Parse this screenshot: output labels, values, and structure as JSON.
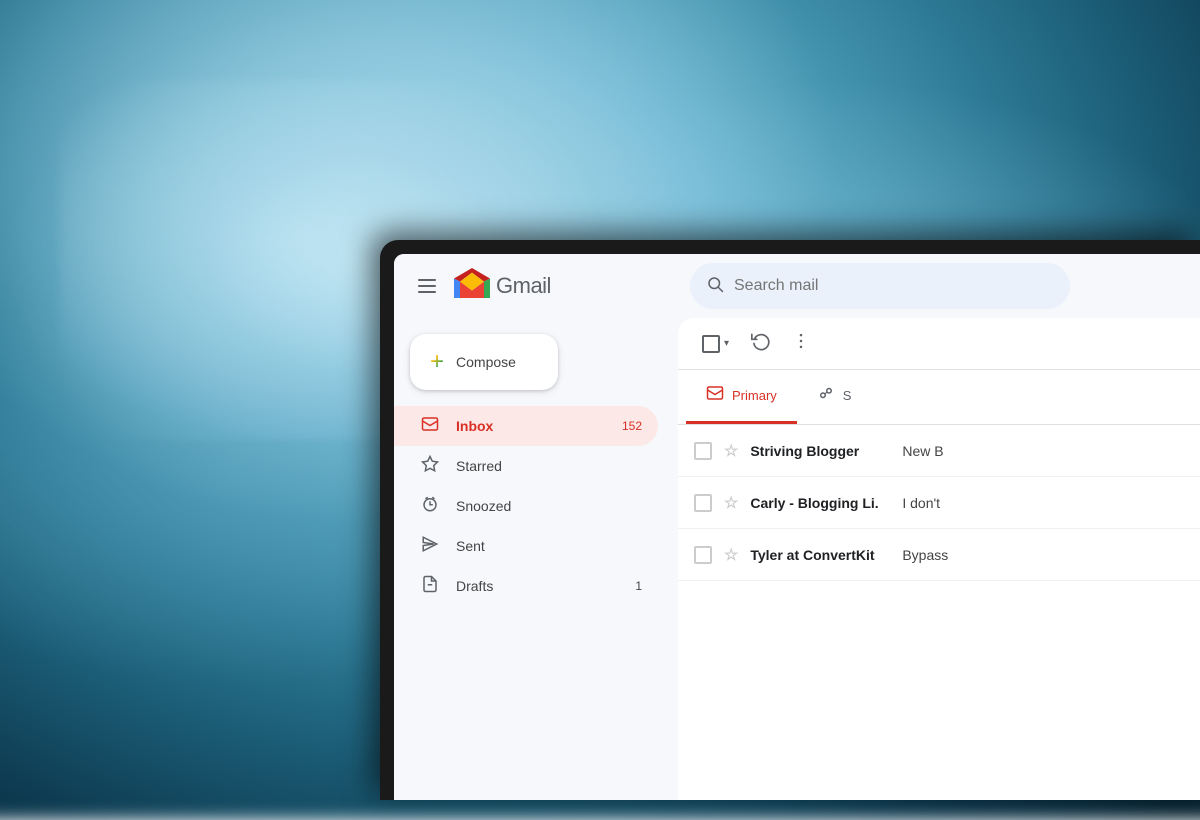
{
  "background": {
    "description": "blurred ocean water background"
  },
  "header": {
    "menu_label": "Main menu",
    "logo_m": "M",
    "app_name": "Gmail",
    "search_placeholder": "Search mail"
  },
  "compose": {
    "label": "Compose",
    "plus_symbol": "+"
  },
  "sidebar": {
    "items": [
      {
        "id": "inbox",
        "label": "Inbox",
        "icon": "inbox",
        "count": "152",
        "active": true
      },
      {
        "id": "starred",
        "label": "Starred",
        "icon": "star",
        "count": "",
        "active": false
      },
      {
        "id": "snoozed",
        "label": "Snoozed",
        "icon": "snoozed",
        "count": "",
        "active": false
      },
      {
        "id": "sent",
        "label": "Sent",
        "icon": "sent",
        "count": "",
        "active": false
      },
      {
        "id": "drafts",
        "label": "Drafts",
        "icon": "drafts",
        "count": "1",
        "active": false
      }
    ]
  },
  "toolbar": {
    "select_all_label": "Select",
    "refresh_label": "Refresh",
    "more_label": "More"
  },
  "tabs": [
    {
      "id": "primary",
      "label": "Primary",
      "icon": "inbox-tab",
      "active": true
    },
    {
      "id": "social",
      "label": "S",
      "icon": "social-tab",
      "active": false
    }
  ],
  "emails": [
    {
      "sender": "Striving Blogger",
      "preview": "New B"
    },
    {
      "sender": "Carly - Blogging Li.",
      "preview": "I don't"
    },
    {
      "sender": "Tyler at ConvertKit",
      "preview": "Bypass"
    }
  ],
  "colors": {
    "brand_red": "#d93025",
    "gmail_blue": "#4285f4",
    "gmail_green": "#34a853",
    "gmail_yellow": "#fbbc05",
    "active_bg": "#fce8e6",
    "search_bg": "#eaf1fb",
    "text_primary": "#202124",
    "text_secondary": "#5f6368"
  }
}
